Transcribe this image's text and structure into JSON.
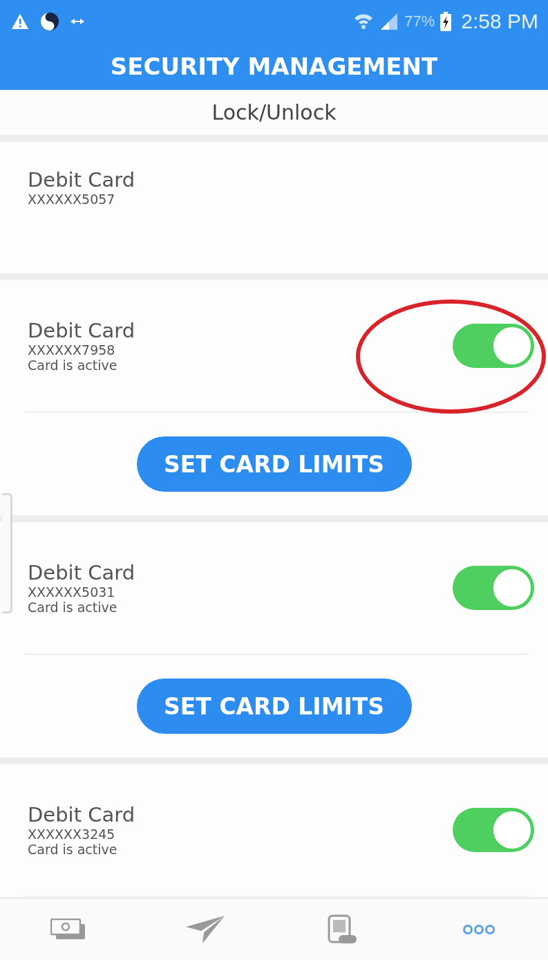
{
  "status_bar": {
    "battery": "77%",
    "time": "2:58 PM"
  },
  "header": {
    "title": "SECURITY MANAGEMENT"
  },
  "subheader": {
    "title": "Lock/Unlock"
  },
  "cards": [
    {
      "kind": "plain",
      "name": "Debit Card",
      "number": "XXXXXX5057"
    },
    {
      "kind": "switch",
      "name": "Debit Card",
      "number": "XXXXXX7958",
      "status": "Card is active",
      "on": true,
      "highlighted": true,
      "button": "SET CARD LIMITS"
    },
    {
      "kind": "switch",
      "name": "Debit Card",
      "number": "XXXXXX5031",
      "status": "Card is active",
      "on": true,
      "highlighted": false,
      "button": "SET CARD LIMITS"
    },
    {
      "kind": "switch",
      "name": "Debit Card",
      "number": "XXXXXX3245",
      "status": "Card is active",
      "on": true,
      "highlighted": false
    }
  ],
  "bottom_nav": [
    {
      "kind": "cash",
      "selected": false
    },
    {
      "kind": "send",
      "selected": false
    },
    {
      "kind": "statement",
      "selected": false
    },
    {
      "kind": "more",
      "selected": true
    }
  ]
}
